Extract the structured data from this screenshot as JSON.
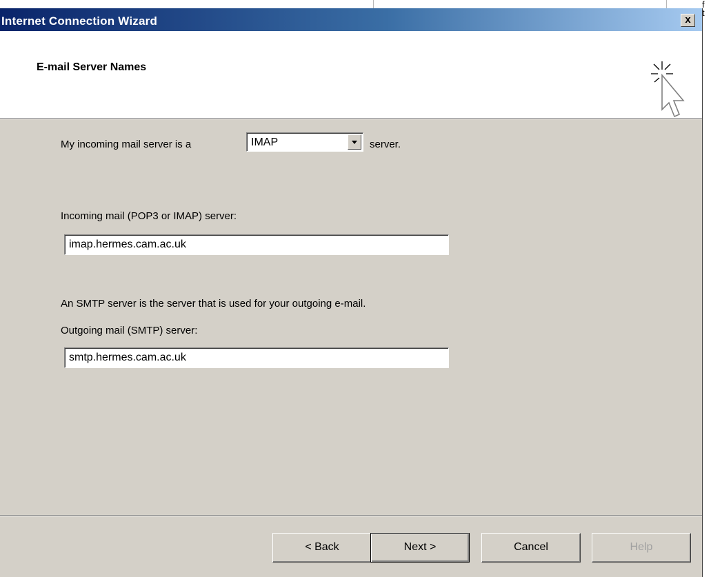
{
  "window": {
    "title": "Internet Connection Wizard",
    "close_glyph": "x"
  },
  "header": {
    "title": "E-mail Server Names",
    "icon": "wizard-cursor-sparkle-icon"
  },
  "form": {
    "server_type_prefix": "My incoming mail server is a",
    "server_type_selected": "IMAP",
    "server_type_suffix": "server.",
    "incoming_label": "Incoming mail (POP3 or IMAP) server:",
    "incoming_value": "imap.hermes.cam.ac.uk",
    "smtp_description": "An SMTP server is the server that is used for your outgoing e-mail.",
    "outgoing_label": "Outgoing mail (SMTP) server:",
    "outgoing_value": "smtp.hermes.cam.ac.uk"
  },
  "buttons": {
    "back": "< Back",
    "next": "Next >",
    "cancel": "Cancel",
    "help": "Help"
  },
  "background": {
    "side_text_1": "f",
    "side_text_2": "t"
  },
  "colors": {
    "titlebar_start": "#0a246a",
    "titlebar_end": "#a6caf0",
    "dialog_bg": "#d4d0c8"
  }
}
